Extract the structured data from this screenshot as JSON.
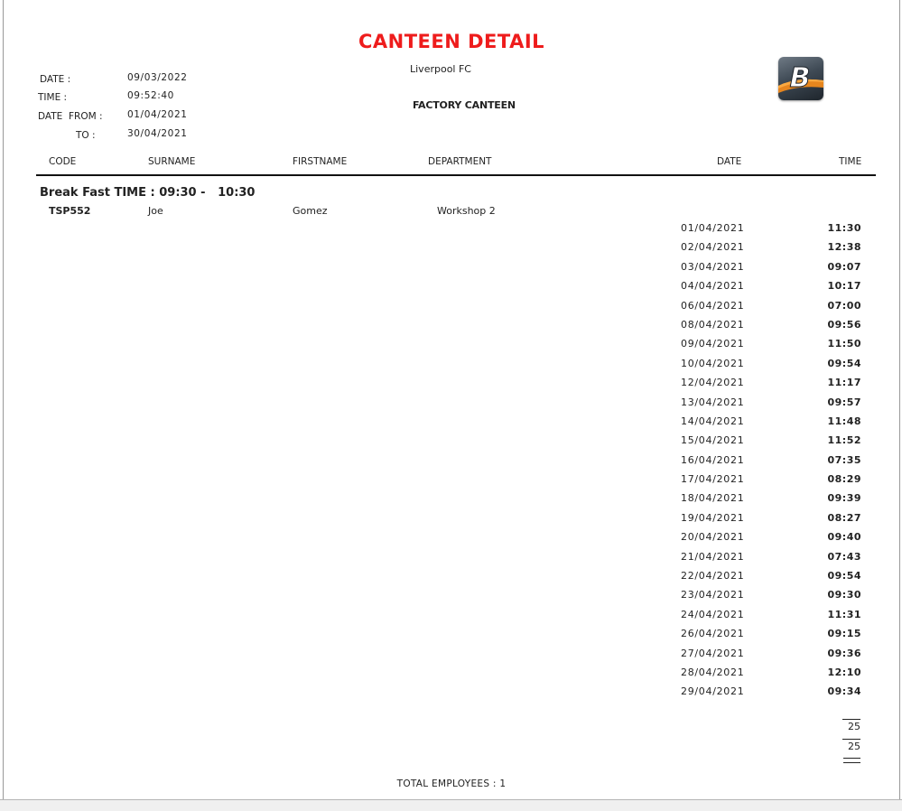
{
  "report": {
    "title": "CANTEEN DETAIL",
    "company": "Liverpool FC",
    "subtitle": "FACTORY CANTEEN",
    "logo_letter": "B"
  },
  "meta": {
    "date_label": "DATE :",
    "date_value": "09/03/2022",
    "time_label": "TIME :",
    "time_value": "09:52:40",
    "from_label": "DATE  FROM :",
    "from_value": "01/04/2021",
    "to_label": "TO :",
    "to_value": "30/04/2021"
  },
  "columns": {
    "code": "CODE",
    "surname": "SURNAME",
    "firstname": "FIRSTNAME",
    "department": "DEPARTMENT",
    "date": "DATE",
    "time": "TIME"
  },
  "group": {
    "title": "Break Fast TIME : 09:30 -   10:30"
  },
  "employee": {
    "code": "TSP552",
    "surname": "Joe",
    "firstname": "Gomez",
    "department": "Workshop 2"
  },
  "entries": [
    {
      "date": "01/04/2021",
      "time": "11:30"
    },
    {
      "date": "02/04/2021",
      "time": "12:38"
    },
    {
      "date": "03/04/2021",
      "time": "09:07"
    },
    {
      "date": "04/04/2021",
      "time": "10:17"
    },
    {
      "date": "06/04/2021",
      "time": "07:00"
    },
    {
      "date": "08/04/2021",
      "time": "09:56"
    },
    {
      "date": "09/04/2021",
      "time": "11:50"
    },
    {
      "date": "10/04/2021",
      "time": "09:54"
    },
    {
      "date": "12/04/2021",
      "time": "11:17"
    },
    {
      "date": "13/04/2021",
      "time": "09:57"
    },
    {
      "date": "14/04/2021",
      "time": "11:48"
    },
    {
      "date": "15/04/2021",
      "time": "11:52"
    },
    {
      "date": "16/04/2021",
      "time": "07:35"
    },
    {
      "date": "17/04/2021",
      "time": "08:29"
    },
    {
      "date": "18/04/2021",
      "time": "09:39"
    },
    {
      "date": "19/04/2021",
      "time": "08:27"
    },
    {
      "date": "20/04/2021",
      "time": "09:40"
    },
    {
      "date": "21/04/2021",
      "time": "07:43"
    },
    {
      "date": "22/04/2021",
      "time": "09:54"
    },
    {
      "date": "23/04/2021",
      "time": "09:30"
    },
    {
      "date": "24/04/2021",
      "time": "11:31"
    },
    {
      "date": "26/04/2021",
      "time": "09:15"
    },
    {
      "date": "27/04/2021",
      "time": "09:36"
    },
    {
      "date": "28/04/2021",
      "time": "12:10"
    },
    {
      "date": "29/04/2021",
      "time": "09:34"
    }
  ],
  "totals": {
    "employee_count": "25",
    "grand_count": "25",
    "footer": "TOTAL EMPLOYEES : 1"
  },
  "colors": {
    "title": "#ee1c1c",
    "logo_accent": "#f08a1c"
  }
}
